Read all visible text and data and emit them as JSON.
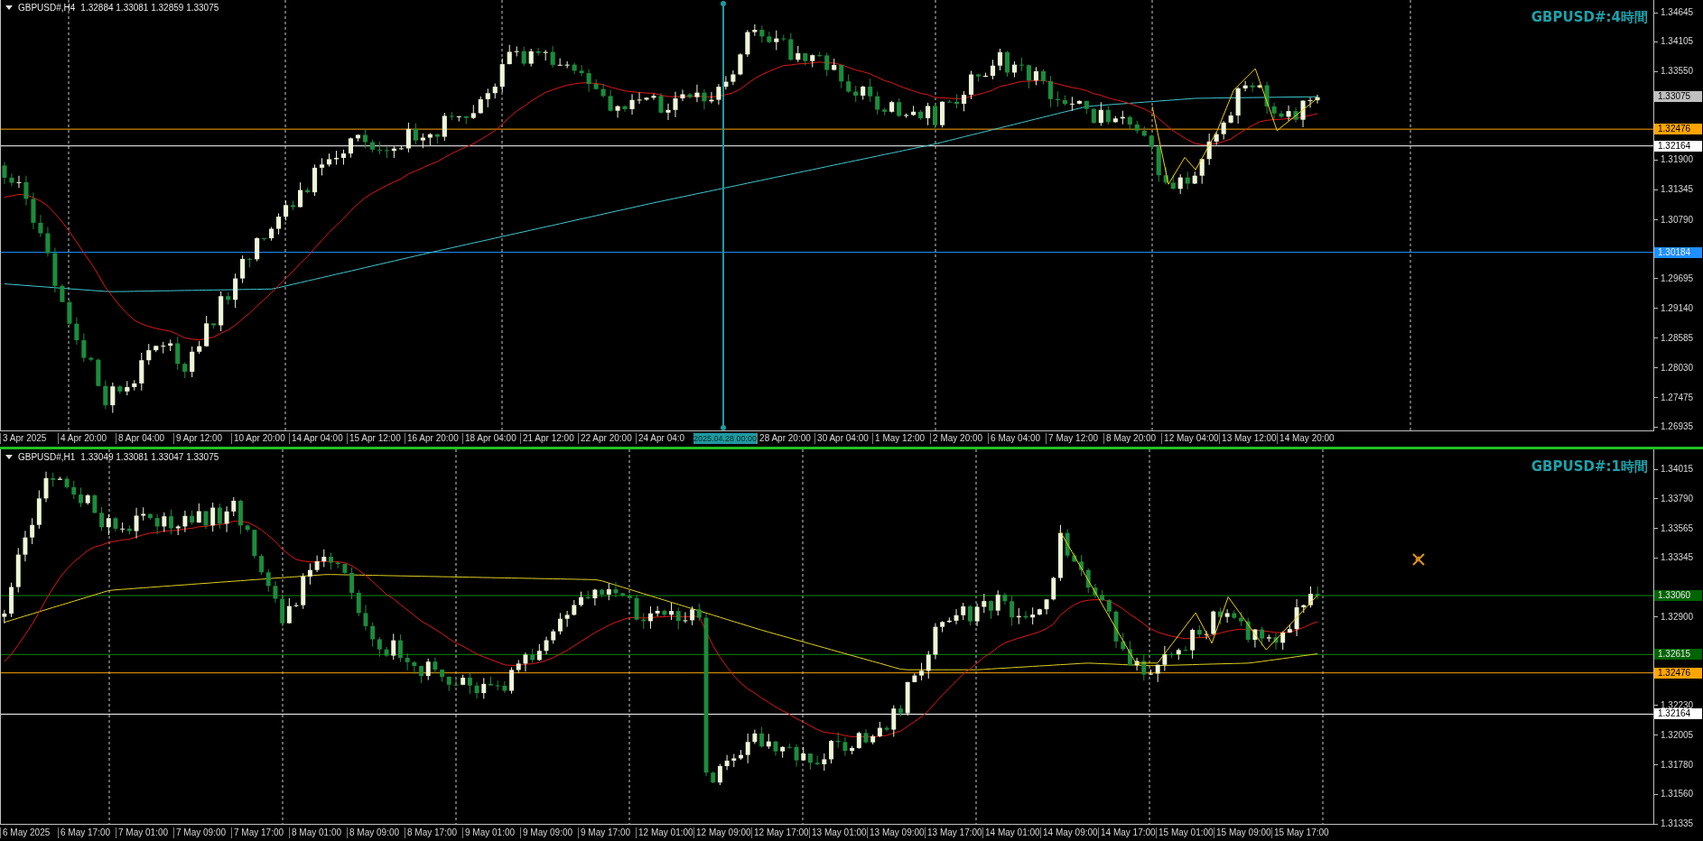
{
  "panes": [
    {
      "header": {
        "symbol": "GBPUSD#,H4",
        "ohlc": "1.32884 1.33081 1.32859 1.33075"
      },
      "title": "GBPUSD#:4時間",
      "price_ticks": [
        "1.34645",
        "1.34105",
        "1.33550",
        "1.31900",
        "1.31345",
        "1.30790",
        "1.29695",
        "1.29140",
        "1.28585",
        "1.28030",
        "1.27475",
        "1.26935"
      ],
      "price_lines": [
        {
          "kind": "bid",
          "price": "1.33075",
          "color": "#c0c0c0"
        },
        {
          "kind": "line",
          "price": "1.32476",
          "color": "#ffa500"
        },
        {
          "kind": "line",
          "price": "1.32164",
          "color": "#ffffff"
        },
        {
          "kind": "line",
          "price": "1.30184",
          "color": "#1e90ff"
        }
      ],
      "time_labels": [
        "3 Apr 2025",
        "4 Apr 20:00",
        "8 Apr 04:00",
        "9 Apr 12:00",
        "10 Apr 20:00",
        "14 Apr 04:00",
        "15 Apr 12:00",
        "16 Apr 20:00",
        "18 Apr 04:00",
        "21 Apr 12:00",
        "22 Apr 20:00",
        "24 Apr 04:0",
        "28 Apr 20:00",
        "30 Apr 04:00",
        "1 May 12:00",
        "2 May 20:00",
        "6 May 04:00",
        "7 May 12:00",
        "8 May 20:00",
        "12 May 04:00",
        "13 May 12:00",
        "14 May 20:00"
      ],
      "crosshair": {
        "label": "2025.04.28 00:00"
      }
    },
    {
      "header": {
        "symbol": "GBPUSD#,H1",
        "ohlc": "1.33049 1.33081 1.33047 1.33075"
      },
      "title": "GBPUSD#:1時間",
      "price_ticks": [
        "1.34015",
        "1.33790",
        "1.33565",
        "1.33345",
        "1.32900",
        "1.32230",
        "1.32005",
        "1.31780",
        "1.31560",
        "1.31335"
      ],
      "price_lines": [
        {
          "kind": "line",
          "price": "1.33060",
          "color": "#006400"
        },
        {
          "kind": "line",
          "price": "1.32615",
          "color": "#006400"
        },
        {
          "kind": "line",
          "price": "1.32476",
          "color": "#ffa500"
        },
        {
          "kind": "line",
          "price": "1.32164",
          "color": "#ffffff"
        }
      ],
      "time_labels": [
        "6 May 2025",
        "6 May 17:00",
        "7 May 01:00",
        "7 May 09:00",
        "7 May 17:00",
        "8 May 01:00",
        "8 May 09:00",
        "8 May 17:00",
        "9 May 01:00",
        "9 May 09:00",
        "9 May 17:00",
        "12 May 01:00",
        "12 May 09:00",
        "12 May 17:00",
        "13 May 01:00",
        "13 May 09:00",
        "13 May 17:00",
        "14 May 01:00",
        "14 May 09:00",
        "14 May 17:00",
        "15 May 01:00",
        "15 May 09:00",
        "15 May 17:00"
      ]
    }
  ]
}
